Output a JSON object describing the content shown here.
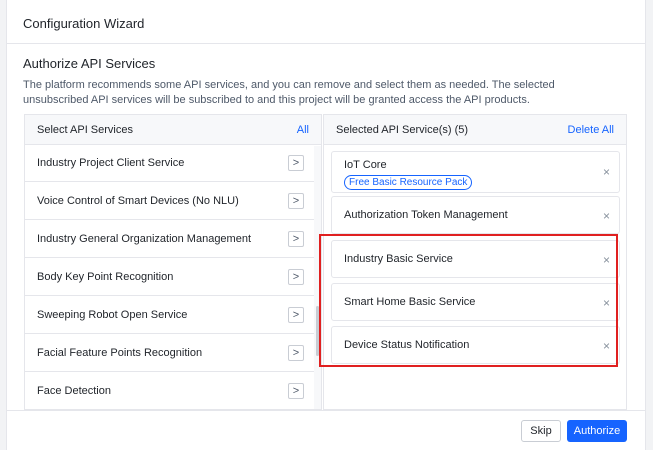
{
  "dialog": {
    "title": "Configuration Wizard"
  },
  "section": {
    "title": "Authorize API Services",
    "description": "The platform recommends some API services, and you can remove and select them as needed. The selected unsubscribed API services will be subscribed to and this project will be granted access the API products."
  },
  "left_panel": {
    "header": "Select API Services",
    "all_link": "All",
    "items": [
      {
        "label": "Industry Project Client Service",
        "arrow": ">"
      },
      {
        "label": "Voice Control of Smart Devices (No NLU)",
        "arrow": ">"
      },
      {
        "label": "Industry General Organization Management",
        "arrow": ">"
      },
      {
        "label": "Body Key Point Recognition",
        "arrow": ">"
      },
      {
        "label": "Sweeping Robot Open Service",
        "arrow": ">"
      },
      {
        "label": "Facial Feature Points Recognition",
        "arrow": ">"
      },
      {
        "label": "Face Detection",
        "arrow": ">"
      }
    ]
  },
  "right_panel": {
    "header": "Selected API Service(s) (5)",
    "delete_all": "Delete All",
    "items": [
      {
        "label": "IoT Core",
        "tag": "Free Basic Resource Pack",
        "remove": "×"
      },
      {
        "label": "Authorization Token Management",
        "remove": "×"
      },
      {
        "label": "Industry Basic Service",
        "remove": "×"
      },
      {
        "label": "Smart Home Basic Service",
        "remove": "×"
      },
      {
        "label": "Device Status Notification",
        "remove": "×"
      }
    ]
  },
  "footer": {
    "skip": "Skip",
    "authorize": "Authorize"
  },
  "colors": {
    "accent": "#1664ff",
    "highlight": "#e02020",
    "border": "#e5e6eb"
  }
}
